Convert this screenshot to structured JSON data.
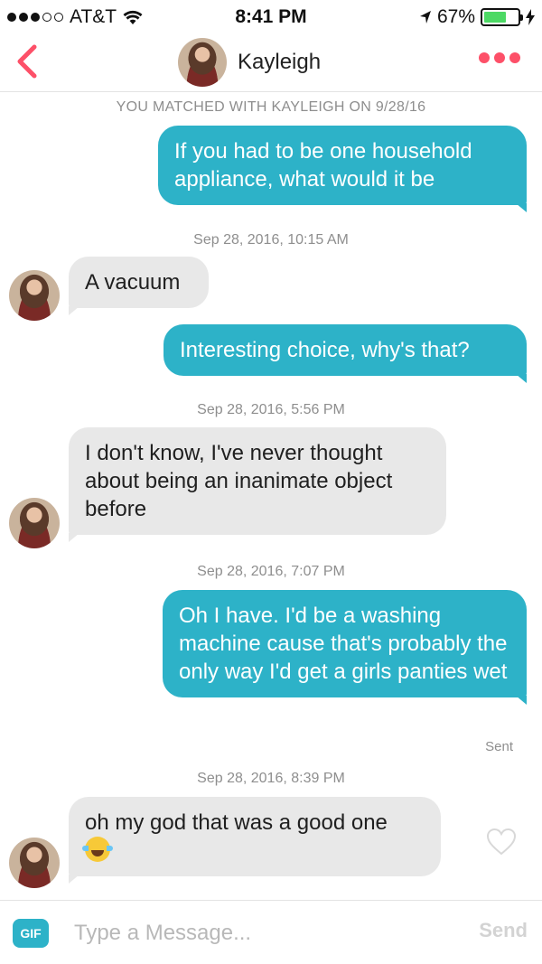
{
  "status_bar": {
    "carrier": "AT&T",
    "time": "8:41 PM",
    "battery": "67%",
    "battery_level": 0.67
  },
  "header": {
    "contact_name": "Kayleigh"
  },
  "match_notice": "YOU MATCHED WITH KAYLEIGH ON 9/28/16",
  "messages": [
    {
      "direction": "outgoing",
      "text": "If you had to be one household appliance, what would it be"
    },
    {
      "direction": "timestamp",
      "text": "Sep 28, 2016, 10:15 AM"
    },
    {
      "direction": "incoming",
      "text": "A vacuum"
    },
    {
      "direction": "outgoing",
      "text": "Interesting choice, why's that?"
    },
    {
      "direction": "timestamp",
      "text": "Sep 28, 2016, 5:56 PM"
    },
    {
      "direction": "incoming",
      "text": "I don't know, I've never thought about being an inanimate object before"
    },
    {
      "direction": "timestamp",
      "text": "Sep 28, 2016, 7:07 PM"
    },
    {
      "direction": "outgoing",
      "text": "Oh I have. I'd be a washing machine cause that's probably the only way I'd get a girls panties wet"
    },
    {
      "direction": "status",
      "text": "Sent"
    },
    {
      "direction": "timestamp",
      "text": "Sep 28, 2016, 8:39 PM"
    },
    {
      "direction": "incoming",
      "text": "oh my god that was a good one",
      "emoji": "face-with-tears-of-joy"
    }
  ],
  "composer": {
    "gif_label": "GIF",
    "placeholder": "Type a Message...",
    "send_label": "Send"
  },
  "colors": {
    "accent": "#fd5068",
    "outgoing_bubble": "#2db2c8",
    "incoming_bubble": "#e8e8e8",
    "battery_fill": "#4cd964"
  }
}
